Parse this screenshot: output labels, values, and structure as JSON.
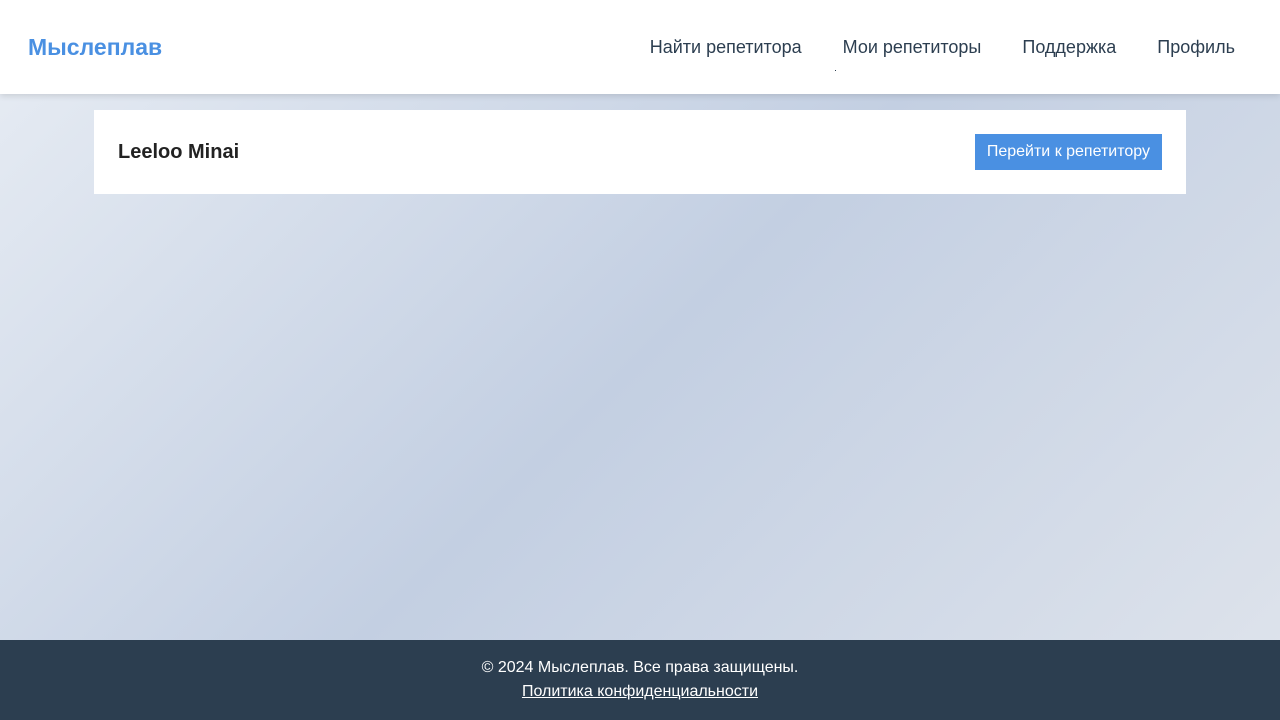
{
  "header": {
    "logo": "Мыслеплав",
    "nav": [
      {
        "label": "Найти репетитора"
      },
      {
        "label": "Мои репетиторы"
      },
      {
        "label": "Поддержка"
      },
      {
        "label": "Профиль"
      }
    ]
  },
  "tutor_card": {
    "name": "Leeloo Minai",
    "button_label": "Перейти к репетитору"
  },
  "footer": {
    "copyright": "© 2024 Мыслеплав. Все права защищены.",
    "privacy_link": "Политика конфиденциальности"
  },
  "colors": {
    "accent": "#4a90e2",
    "footer_bg": "#2c3e50",
    "nav_text": "#2c3e50"
  }
}
